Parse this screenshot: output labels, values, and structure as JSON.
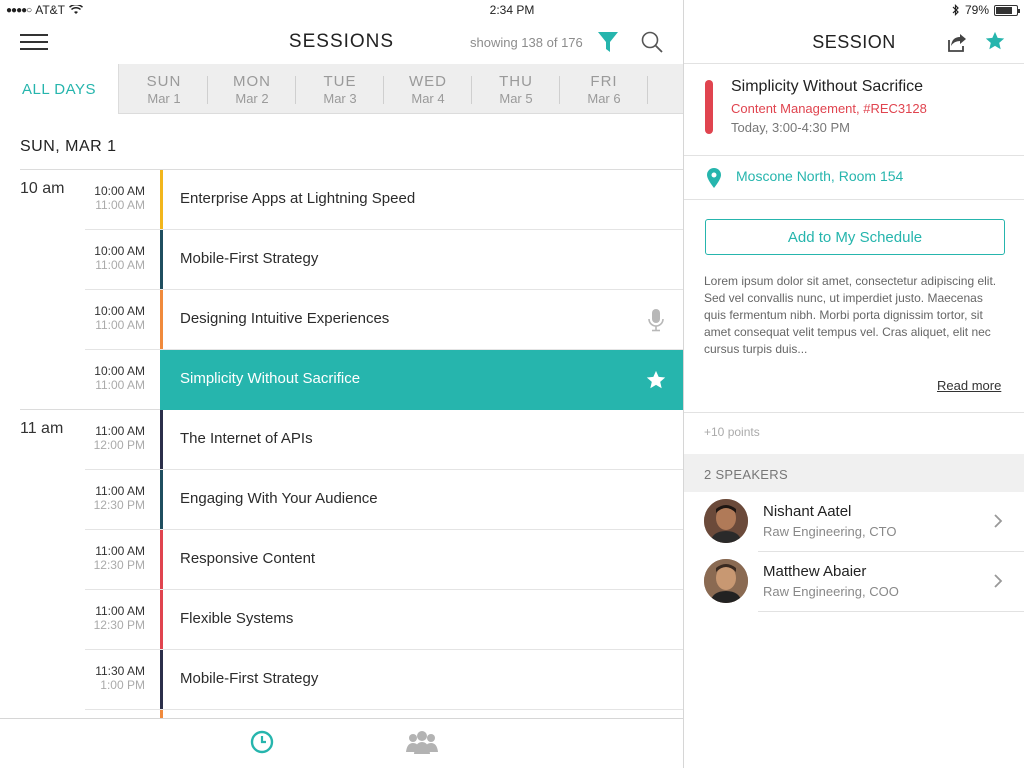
{
  "status_bar": {
    "carrier": "AT&T",
    "time": "2:34 PM",
    "battery": "79%",
    "battery_level": 0.79
  },
  "sessions_pane": {
    "title": "SESSIONS",
    "showing": "showing 138 of 176",
    "tabs": {
      "all": "ALL DAYS",
      "days": [
        {
          "day": "SUN",
          "date": "Mar 1"
        },
        {
          "day": "MON",
          "date": "Mar 2"
        },
        {
          "day": "TUE",
          "date": "Mar 3"
        },
        {
          "day": "WED",
          "date": "Mar 4"
        },
        {
          "day": "THU",
          "date": "Mar 5"
        },
        {
          "day": "FRI",
          "date": "Mar 6"
        }
      ]
    },
    "date_header": "SUN, MAR 1",
    "hours": [
      "10 am",
      "11 am"
    ],
    "sessions": [
      {
        "start": "10:00 AM",
        "end": "11:00 AM",
        "title": "Enterprise Apps at Lightning Speed",
        "color": "#f2b61c"
      },
      {
        "start": "10:00 AM",
        "end": "11:00 AM",
        "title": "Mobile-First Strategy",
        "color": "#1f4e5f"
      },
      {
        "start": "10:00 AM",
        "end": "11:00 AM",
        "title": "Designing Intuitive Experiences",
        "color": "#f08a3c",
        "icon": "microphone-icon"
      },
      {
        "start": "10:00 AM",
        "end": "11:00 AM",
        "title": "Simplicity Without Sacrifice",
        "color": "#26b5ad",
        "selected": true,
        "icon": "star-icon"
      },
      {
        "start": "11:00 AM",
        "end": "12:00 PM",
        "title": "The Internet of APIs",
        "color": "#2b2f4a"
      },
      {
        "start": "11:00 AM",
        "end": "12:30 PM",
        "title": "Engaging With Your Audience",
        "color": "#1f4e5f"
      },
      {
        "start": "11:00 AM",
        "end": "12:30 PM",
        "title": "Responsive Content",
        "color": "#e0444f"
      },
      {
        "start": "11:00 AM",
        "end": "12:30 PM",
        "title": "Flexible Systems",
        "color": "#e0444f"
      },
      {
        "start": "11:30 AM",
        "end": "1:00 PM",
        "title": "Mobile-First Strategy",
        "color": "#2b2f4a"
      }
    ]
  },
  "detail_pane": {
    "title": "SESSION",
    "session_title": "Simplicity Without Sacrifice",
    "track": "Content Management, #REC3128",
    "when": "Today, 3:00-4:30 PM",
    "location": "Moscone North, Room 154",
    "add_button": "Add to My Schedule",
    "description": "Lorem ipsum dolor sit amet, consectetur adipiscing elit. Sed vel convallis nunc, ut imperdiet justo. Maecenas quis fermentum nibh. Morbi porta dignissim tortor, sit amet consequat velit tempus vel. Cras aliquet, elit nec cursus turpis duis...",
    "read_more": "Read more",
    "points": "+10 points",
    "speakers_header": "2 SPEAKERS",
    "speakers": [
      {
        "name": "Nishant Aatel",
        "role": "Raw Engineering, CTO"
      },
      {
        "name": "Matthew Abaier",
        "role": "Raw Engineering, COO"
      }
    ]
  },
  "colors": {
    "accent": "#26b5ad",
    "track_red": "#e0444f"
  }
}
